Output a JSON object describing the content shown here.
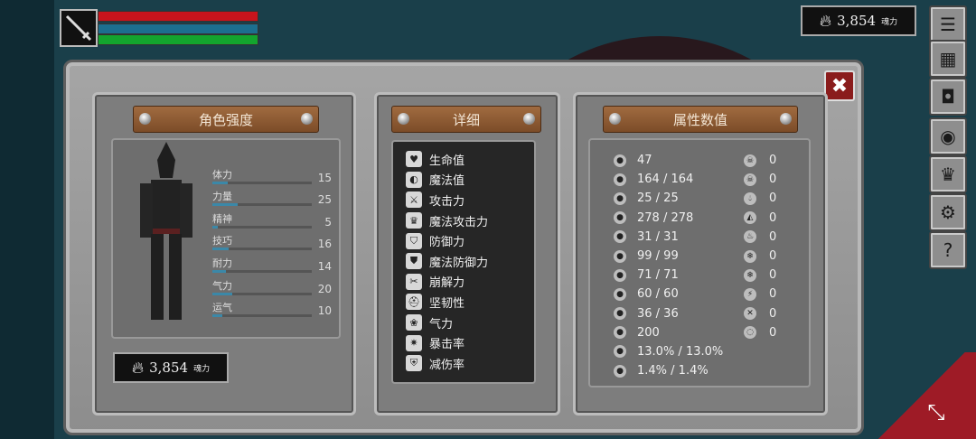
{
  "hud": {
    "souls_value": "3,854",
    "souls_unit": "魂力",
    "hp_color": "#c8141c",
    "mp_color": "#1c6f8f",
    "stamina_color": "#13a52e",
    "weapon_icon": "sword-icon"
  },
  "right_menu": {
    "items": [
      "menu-icon",
      "armor-icon",
      "helmet-icon",
      "shield-icon",
      "crown-icon",
      "gear-icon",
      "help-icon"
    ],
    "help_glyph": "?"
  },
  "left_panel": {
    "title": "角色强度",
    "stats": [
      {
        "label": "体力",
        "value": "15",
        "fill": 0.15
      },
      {
        "label": "力量",
        "value": "25",
        "fill": 0.25
      },
      {
        "label": "精神",
        "value": "5",
        "fill": 0.05
      },
      {
        "label": "技巧",
        "value": "16",
        "fill": 0.16
      },
      {
        "label": "耐力",
        "value": "14",
        "fill": 0.14
      },
      {
        "label": "气力",
        "value": "20",
        "fill": 0.2
      },
      {
        "label": "运气",
        "value": "10",
        "fill": 0.1
      }
    ],
    "souls_value": "3,854",
    "souls_unit": "魂力"
  },
  "detail_panel": {
    "title": "详细",
    "items": [
      "生命值",
      "魔法值",
      "攻击力",
      "魔法攻击力",
      "防御力",
      "魔法防御力",
      "崩解力",
      "坚韧性",
      "气力",
      "暴击率",
      "减伤率"
    ]
  },
  "attr_panel": {
    "title": "属性数值",
    "values": [
      "47",
      "164 / 164",
      "25 / 25",
      "278 / 278",
      "31 / 31",
      "99 / 99",
      "71 / 71",
      "60 / 60",
      "36 / 36",
      "200",
      "13.0% / 13.0%",
      "1.4% / 1.4%"
    ],
    "elements": [
      "0",
      "0",
      "0",
      "0",
      "0",
      "0",
      "0",
      "0",
      "0",
      "0"
    ]
  },
  "close_glyph": "✖"
}
